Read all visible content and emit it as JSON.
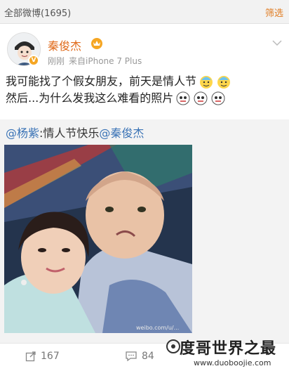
{
  "topbar": {
    "title": "全部微博(1695)",
    "filter_label": "筛选"
  },
  "user": {
    "name": "秦俊杰",
    "time": "刚刚",
    "source": "来自iPhone 7 Plus",
    "badge": "V"
  },
  "post": {
    "line1": "我可能找了个假女朋友，前天是情人节",
    "line2": "然后...为什么发我这么难看的照片"
  },
  "repost": {
    "mention1": "@杨紫",
    "text": ":情人节快乐",
    "mention2": "@秦俊杰"
  },
  "photo": {
    "watermark": "weibo.com/u/..."
  },
  "actions": {
    "repost_count": "167",
    "comment_count": "84"
  },
  "site_watermark": {
    "title": "度哥世界之最",
    "url": "www.duoboojie.com"
  },
  "colors": {
    "username": "#e06a1a",
    "mention": "#3a73b6",
    "filter": "#e07b20",
    "badge": "#f5a623"
  },
  "icons": [
    "chevron-down-icon",
    "repost-icon",
    "comment-icon",
    "member-crown-icon",
    "verified-badge-icon",
    "emoji-icon"
  ]
}
